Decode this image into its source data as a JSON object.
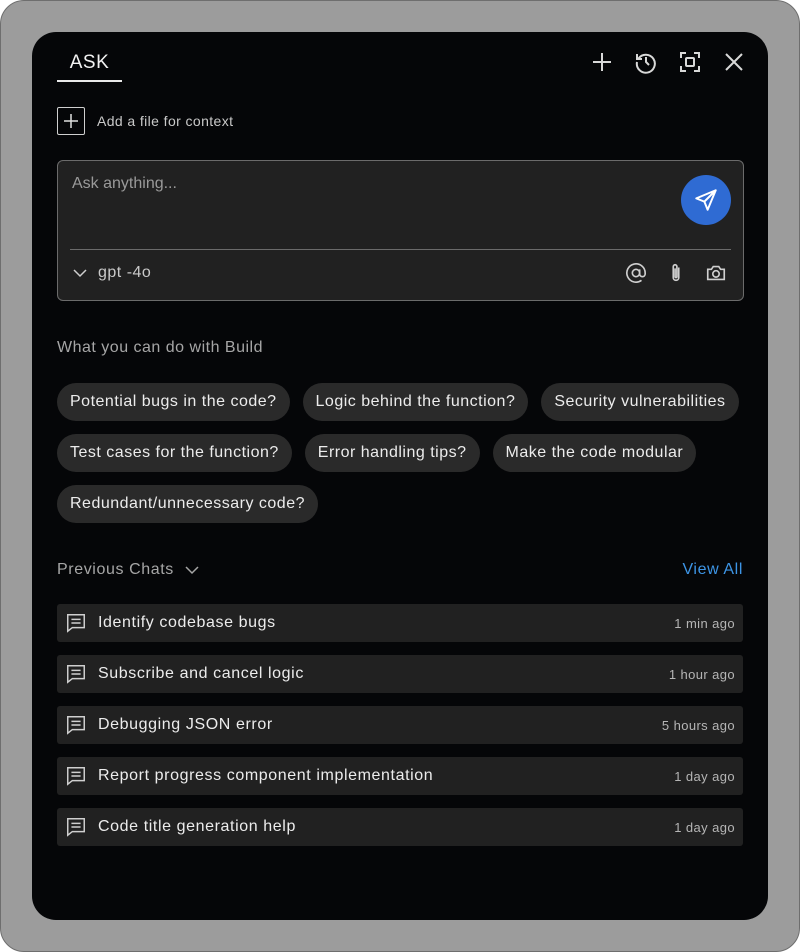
{
  "header": {
    "tab_label": "ASK",
    "icons": [
      "plus-icon",
      "history-icon",
      "expand-icon",
      "close-icon"
    ]
  },
  "context": {
    "add_file_label": "Add a file for context"
  },
  "ask": {
    "placeholder": "Ask anything...",
    "value": "",
    "model": "gpt -4o",
    "send_color": "#2f6bd3",
    "tools": [
      "mention-icon",
      "attach-icon",
      "camera-icon"
    ]
  },
  "suggestions": {
    "title": "What you can do with Build",
    "chips": [
      "Potential bugs in the code?",
      "Logic behind the function?",
      "Security vulnerabilities",
      "Test cases for the function?",
      "Error handling tips?",
      "Make the code modular",
      "Redundant/unnecessary code?"
    ]
  },
  "previous": {
    "title": "Previous Chats",
    "view_all": "View All",
    "view_all_color": "#3d95e6",
    "chats": [
      {
        "title": "Identify codebase bugs",
        "time": "1 min ago"
      },
      {
        "title": "Subscribe and cancel logic",
        "time": "1 hour ago"
      },
      {
        "title": "Debugging JSON error",
        "time": "5 hours ago"
      },
      {
        "title": "Report progress component implementation",
        "time": "1 day ago"
      },
      {
        "title": "Code title generation help",
        "time": "1 day ago"
      }
    ]
  }
}
